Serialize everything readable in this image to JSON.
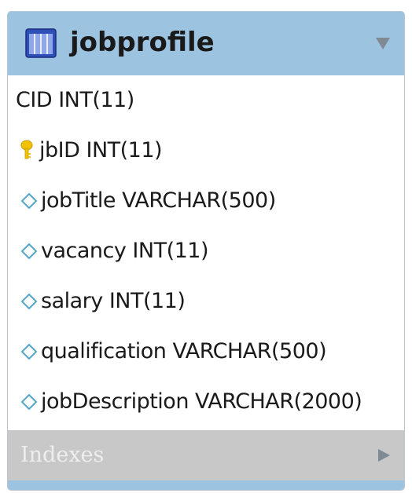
{
  "table": {
    "name": "jobprofile",
    "header_color": "#9cc3e0",
    "icons": {
      "table": "table-icon",
      "collapse": "triangle-down-icon",
      "expand": "triangle-right-icon"
    }
  },
  "columns": [
    {
      "label": "CID INT(11)",
      "icon": "none"
    },
    {
      "label": "jbID INT(11)",
      "icon": "primary-key-icon"
    },
    {
      "label": "jobTitle VARCHAR(500)",
      "icon": "diamond-icon"
    },
    {
      "label": "vacancy INT(11)",
      "icon": "diamond-icon"
    },
    {
      "label": "salary INT(11)",
      "icon": "diamond-icon"
    },
    {
      "label": "qualification VARCHAR(500)",
      "icon": "diamond-icon"
    },
    {
      "label": "jobDescription VARCHAR(2000)",
      "icon": "diamond-icon"
    }
  ],
  "indexes": {
    "label": "Indexes"
  }
}
